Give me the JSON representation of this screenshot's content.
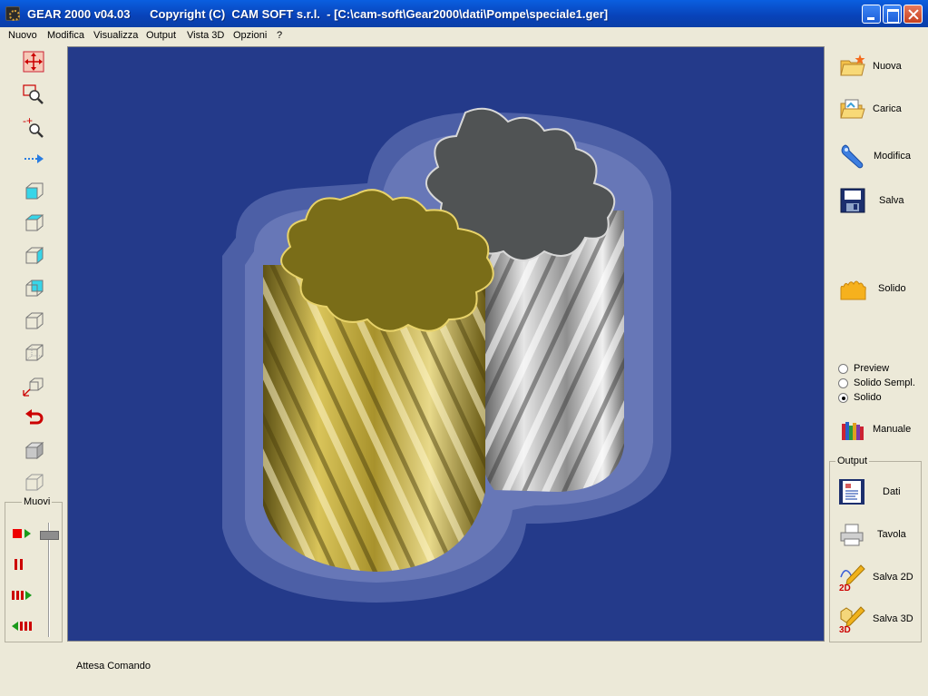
{
  "window": {
    "title": "GEAR 2000 v04.03      Copyright (C)  CAM SOFT s.r.l.  - [C:\\cam-soft\\Gear2000\\dati\\Pompe\\speciale1.ger]"
  },
  "menu": [
    "Nuovo",
    "Modifica",
    "Visualizza",
    "Output",
    "Vista 3D",
    "Opzioni",
    "?"
  ],
  "left_toolbar": {
    "muovi_label": "Muovi"
  },
  "right_panel": {
    "buttons": [
      {
        "label": "Nuova",
        "icon": "folder-new-icon"
      },
      {
        "label": "Carica",
        "icon": "folder-open-icon"
      },
      {
        "label": "Modifica",
        "icon": "wrench-icon"
      },
      {
        "label": "Salva",
        "icon": "floppy-icon"
      },
      {
        "label": "Solido",
        "icon": "solid-profile-icon"
      }
    ],
    "view_modes": [
      {
        "label": "Preview",
        "selected": false
      },
      {
        "label": "Solido Sempl.",
        "selected": false
      },
      {
        "label": "Solido",
        "selected": true
      }
    ],
    "manual_label": "Manuale",
    "output": {
      "legend": "Output",
      "buttons": [
        {
          "label": "Dati",
          "icon": "data-sheet-icon"
        },
        {
          "label": "Tavola",
          "icon": "printer-icon"
        },
        {
          "label": "Salva 2D",
          "icon": "save-2d-icon"
        },
        {
          "label": "Salva 3D",
          "icon": "save-3d-icon"
        }
      ]
    }
  },
  "status": {
    "text": "Attesa Comando"
  },
  "colors": {
    "viewport_bg": "#243a8a",
    "gold_gear": "#b8a235",
    "silver_gear": "#a8a8a8"
  }
}
